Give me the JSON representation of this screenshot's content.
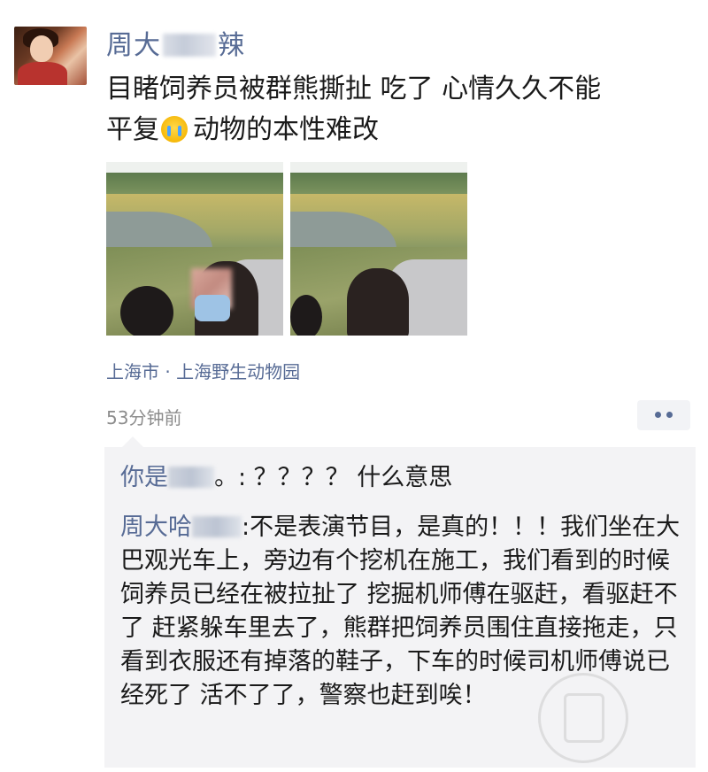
{
  "post": {
    "username_visible_start": "周大",
    "username_visible_end": "辣",
    "text_line1": "目睹饲养员被群熊撕扯 吃了 心情久久不能",
    "text_line2_a": "平复",
    "text_line2_b": "动物的本性难改",
    "emoji_icon": "crying-face-icon",
    "location": "上海市 · 上海野生动物园",
    "time": "53分钟前"
  },
  "comments": [
    {
      "name_visible_start": "你是",
      "text": "。: ？？？？ 什么意思"
    },
    {
      "name_visible_start": "周大哈",
      "text": ":不是表演节目，是真的！！！我们坐在大巴观光车上，旁边有个挖机在施工，我们看到的时候饲养员已经在被拉扯了 挖掘机师傅在驱赶，看驱赶不了 赶紧躲车里去了，熊群把饲养员围住直接拖走，只看到衣服还有掉落的鞋子，下车的时候司机师傅说已经死了 活不了了，警察也赶到唉！"
    }
  ],
  "colors": {
    "link_blue": "#576b95",
    "comment_bg": "#f3f3f5",
    "time_gray": "#8c8c8c"
  }
}
